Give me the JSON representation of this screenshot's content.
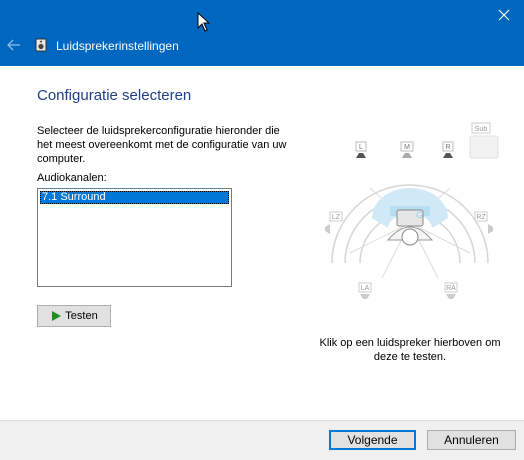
{
  "window": {
    "title": "Luidsprekerinstellingen",
    "accent_color": "#0067c0",
    "close_icon": "close-icon",
    "back_icon": "back-arrow-icon",
    "app_icon": "speaker-app-icon"
  },
  "main": {
    "heading": "Configuratie selecteren",
    "description": "Selecteer de luidsprekerconfiguratie hieronder die het meest overeenkomt met de configuratie van uw computer.",
    "channels_label": "Audiokanalen:",
    "channels": [
      "7.1 Surround"
    ],
    "selected_channel": "7.1 Surround",
    "test_button": "Testen"
  },
  "diagram": {
    "speakers": {
      "L": "L",
      "M": "M",
      "R": "R",
      "Sub": "Sub",
      "LZ": "LZ",
      "RZ": "RZ",
      "LA": "LA",
      "RA": "RA"
    },
    "help_text": "Klik op een luidspreker hierboven om deze te testen."
  },
  "footer": {
    "next_button": "Volgende",
    "cancel_button": "Annuleren"
  }
}
